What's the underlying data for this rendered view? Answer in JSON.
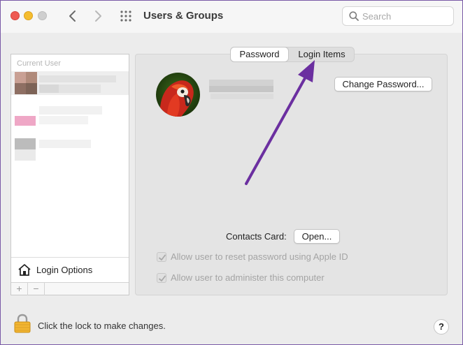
{
  "window": {
    "title": "Users & Groups",
    "traffic_lights": [
      "close",
      "minimize",
      "zoom"
    ]
  },
  "toolbar": {
    "back_icon": "chevron-left-icon",
    "forward_icon": "chevron-right-icon",
    "show_all_icon": "grid-icon",
    "search_placeholder": "Search"
  },
  "sidebar": {
    "header": "Current User",
    "login_options_label": "Login Options",
    "add_label": "+",
    "remove_label": "−"
  },
  "tabs": [
    {
      "label": "Password",
      "selected": true
    },
    {
      "label": "Login Items",
      "selected": false
    }
  ],
  "account": {
    "change_password_label": "Change Password...",
    "contacts_card_label": "Contacts Card:",
    "open_label": "Open...",
    "options": [
      {
        "label": "Allow user to reset password using Apple ID",
        "checked": true,
        "enabled": false
      },
      {
        "label": "Allow user to administer this computer",
        "checked": true,
        "enabled": false
      }
    ]
  },
  "footer": {
    "lock_text": "Click the lock to make changes.",
    "help_label": "?"
  },
  "colors": {
    "annotation_arrow": "#6b2fa0",
    "close": "#ee5a52",
    "minimize": "#f5bd2f",
    "zoom": "#cfcfcf"
  }
}
